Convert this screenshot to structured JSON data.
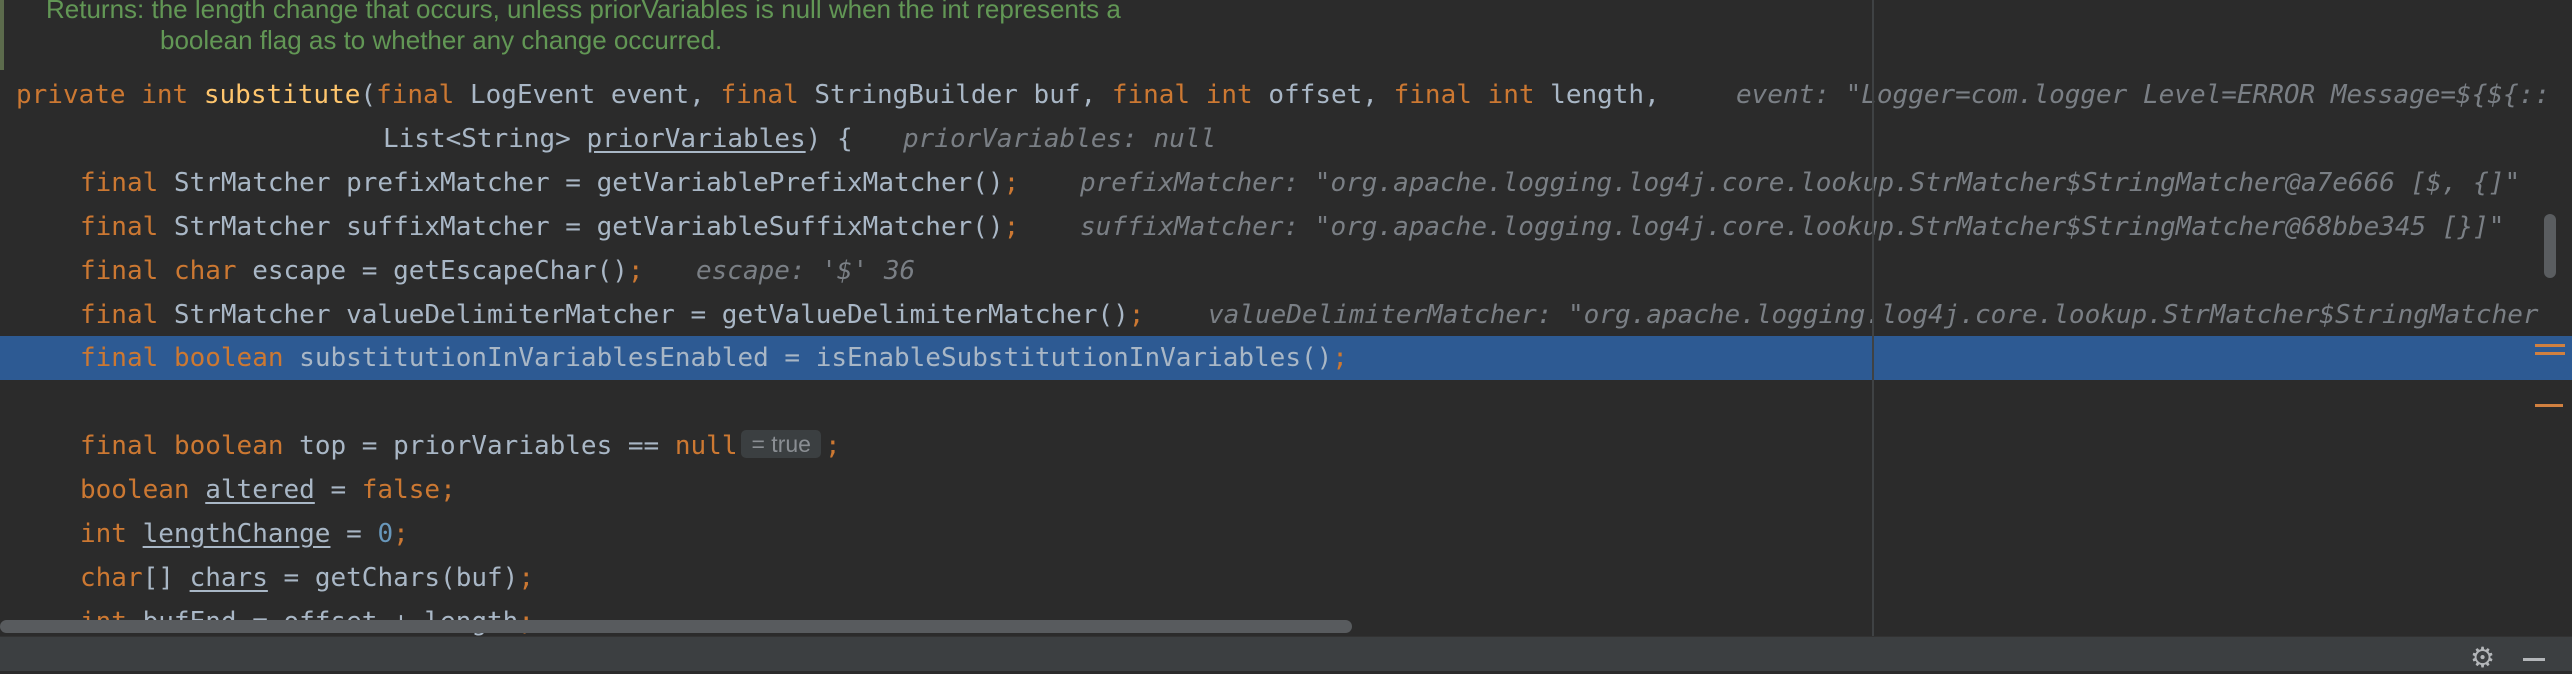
{
  "doc_comment": {
    "line1": "Returns: the length change that occurs, unless priorVariables is null when the int represents a",
    "line2": "boolean flag as to whether any change occurred."
  },
  "code": {
    "sig": {
      "private": "private",
      "int": "int",
      "name": "substitute",
      "open": "(",
      "final1": "final",
      "p1": " LogEvent event, ",
      "final2": "final",
      "p2": " StringBuilder buf, ",
      "final3": "final",
      "int2": "int",
      "p3": " offset, ",
      "final4": "final",
      "int3": "int",
      "p4": " length,",
      "hint": "event: \"Logger=com.logger Level=ERROR Message=${${::"
    },
    "sig2": {
      "type": "List<String> ",
      "param": "priorVariables",
      "rest": ") {",
      "hint": "priorVariables: null"
    },
    "l_prefix": {
      "final": "final",
      "text": " StrMatcher prefixMatcher = getVariablePrefixMatcher()",
      "semi": ";",
      "hint": "prefixMatcher: \"org.apache.logging.log4j.core.lookup.StrMatcher$StringMatcher@a7e666 [$, {]\""
    },
    "l_suffix": {
      "final": "final",
      "text": " StrMatcher suffixMatcher = getVariableSuffixMatcher()",
      "semi": ";",
      "hint": "suffixMatcher: \"org.apache.logging.log4j.core.lookup.StrMatcher$StringMatcher@68bbe345 [}]\""
    },
    "l_escape": {
      "final": "final",
      "char": "char",
      "text": " escape = getEscapeChar()",
      "semi": ";",
      "hint": "escape: '$' 36"
    },
    "l_delim": {
      "final": "final",
      "text": " StrMatcher valueDelimiterMatcher = getValueDelimiterMatcher()",
      "semi": ";",
      "hint": "valueDelimiterMatcher: \"org.apache.logging.log4j.core.lookup.StrMatcher$StringMatcher"
    },
    "l_subst": {
      "final": "final",
      "boolean": "boolean",
      "text": " substitutionInVariablesEnabled = isEnableSubstitutionInVariables()",
      "semi": ";"
    },
    "l_top": {
      "final": "final",
      "boolean": "boolean",
      "text": " top = priorVariables == ",
      "null": "null",
      "chip": "= true",
      "semi": ";"
    },
    "l_altered": {
      "boolean": "boolean",
      "var": "altered",
      "eq": " = ",
      "false": "false",
      "semi": ";"
    },
    "l_length": {
      "int": "int",
      "var": "lengthChange",
      "eq": " = ",
      "zero": "0",
      "semi": ";"
    },
    "l_chars": {
      "char": "char",
      "brackets": "[] ",
      "var": "chars",
      "rest": " = getChars(buf)",
      "semi": ";"
    },
    "l_bufend": {
      "int": "int",
      "text": " bufEnd = offset + length",
      "semi": ";"
    }
  },
  "icons": {
    "settings": "gear-icon",
    "hide": "minus-icon"
  },
  "colors": {
    "background": "#2b2b2b",
    "selection": "#2d5a93",
    "keyword": "#cc7832",
    "method": "#ffc66d",
    "number": "#6897bb",
    "doc_comment": "#629755",
    "inline_hint": "#7a7f85"
  }
}
